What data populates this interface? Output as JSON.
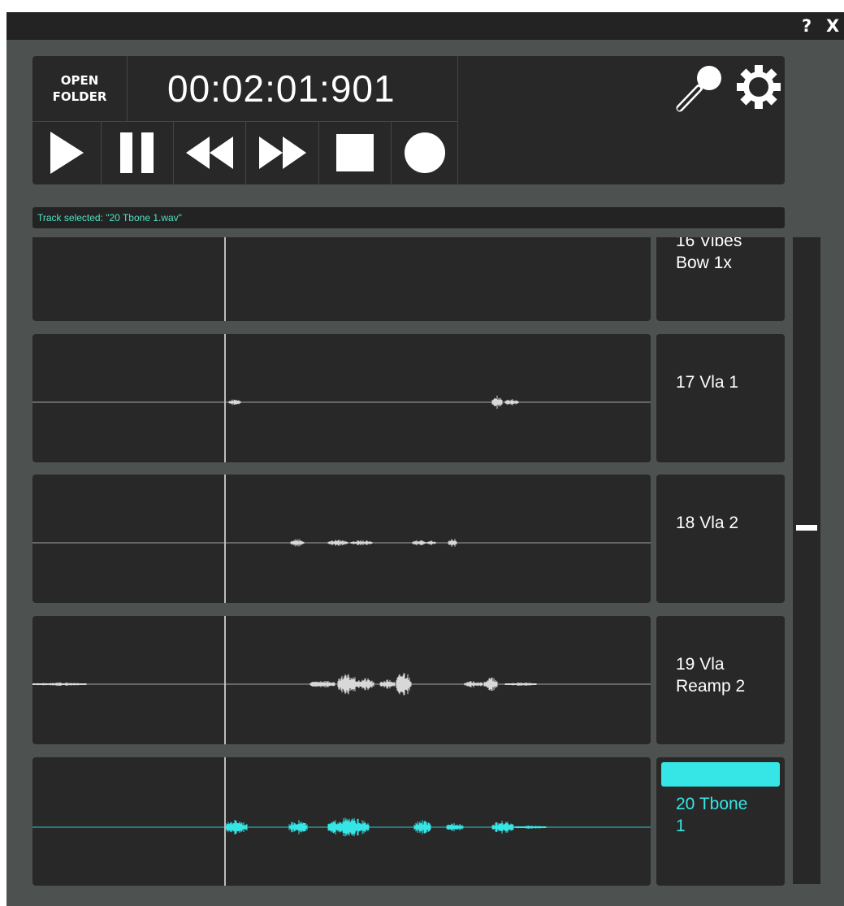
{
  "titlebar": {
    "help_label": "?",
    "close_label": "X"
  },
  "transport": {
    "open_folder_label": "OPEN\nFOLDER",
    "timecode": "00:02:01:901",
    "buttons": [
      {
        "name": "play-button",
        "icon": "play-icon"
      },
      {
        "name": "pause-button",
        "icon": "pause-icon"
      },
      {
        "name": "rewind-button",
        "icon": "rewind-icon"
      },
      {
        "name": "fast-forward-button",
        "icon": "fast-forward-icon"
      },
      {
        "name": "stop-button",
        "icon": "stop-icon"
      },
      {
        "name": "record-button",
        "icon": "record-icon"
      }
    ],
    "mic_icon": "microphone-icon",
    "settings_icon": "gear-icon"
  },
  "status": {
    "text": "Track selected: \"20 Tbone 1.wav\""
  },
  "tracks": [
    {
      "name": "16 Vibes\nBow 1x",
      "selected": false
    },
    {
      "name": "17 Vla 1",
      "selected": false
    },
    {
      "name": "18 Vla 2",
      "selected": false
    },
    {
      "name": "19 Vla\nReamp 2",
      "selected": false
    },
    {
      "name": "20 Tbone\n1",
      "selected": true
    }
  ],
  "colors": {
    "background": "#4d5150",
    "panel": "#282828",
    "titlebar": "#232323",
    "waveform": "#d8d8d8",
    "selected_accent": "#36e6e6",
    "status_text": "#4fe0c4"
  }
}
